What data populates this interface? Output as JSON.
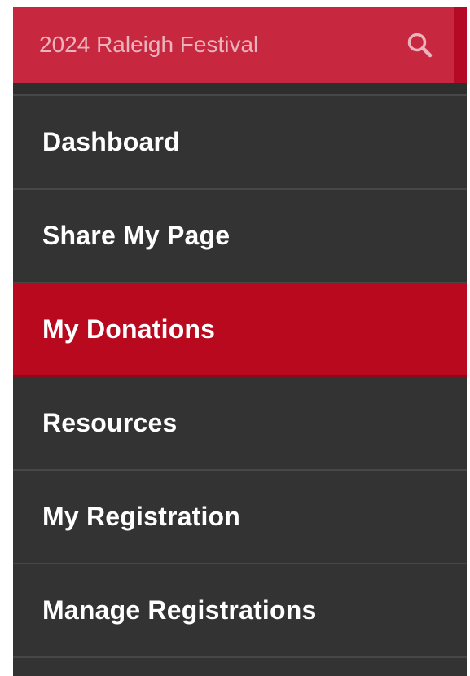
{
  "search": {
    "placeholder": "2024 Raleigh Festival",
    "icon": "search-icon"
  },
  "menu": {
    "items": [
      {
        "label": "Dashboard",
        "active": false
      },
      {
        "label": "Share My Page",
        "active": false
      },
      {
        "label": "My Donations",
        "active": true
      },
      {
        "label": "Resources",
        "active": false
      },
      {
        "label": "My Registration",
        "active": false
      },
      {
        "label": "Manage Registrations",
        "active": false
      }
    ]
  },
  "colors": {
    "search_bar": "#c8283f",
    "active_item": "#b8091f",
    "panel": "#333333",
    "text": "#ffffff"
  }
}
